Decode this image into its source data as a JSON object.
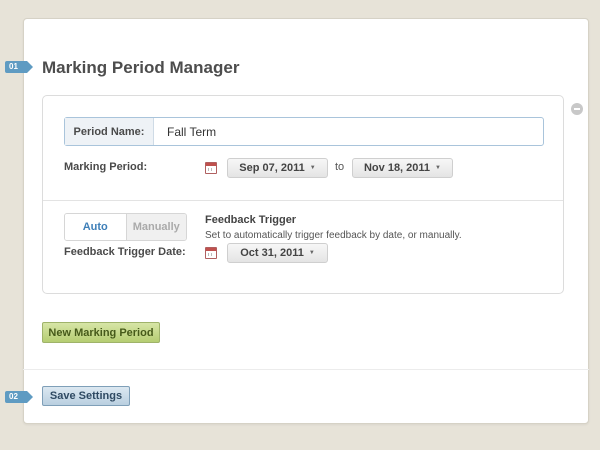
{
  "steps": {
    "one": "01",
    "two": "02"
  },
  "page_title": "Marking Period Manager",
  "period": {
    "name_label": "Period Name:",
    "name_value": "Fall Term",
    "marking_period_label": "Marking Period:",
    "start_date": "Sep 07, 2011",
    "to_label": "to",
    "end_date": "Nov 18, 2011"
  },
  "feedback": {
    "toggle_options": [
      "Auto",
      "Manually"
    ],
    "selected": "Auto",
    "trigger_title": "Feedback Trigger",
    "trigger_description": "Set to automatically trigger feedback by date, or manually.",
    "trigger_date_label": "Feedback Trigger Date:",
    "trigger_date": "Oct 31, 2011"
  },
  "buttons": {
    "new_marking_period": "New Marking Period",
    "save_settings": "Save Settings"
  },
  "icons": {
    "remove": "minus-circle-icon",
    "calendar": "calendar-icon",
    "dropdown": "caret-down-icon"
  },
  "colors": {
    "background": "#e7e3d8",
    "step_tag": "#5f9bc2",
    "new_button": "#b5cd72",
    "save_button": "#b9cfe0",
    "toggle_selected_text": "#3e7fb8"
  }
}
